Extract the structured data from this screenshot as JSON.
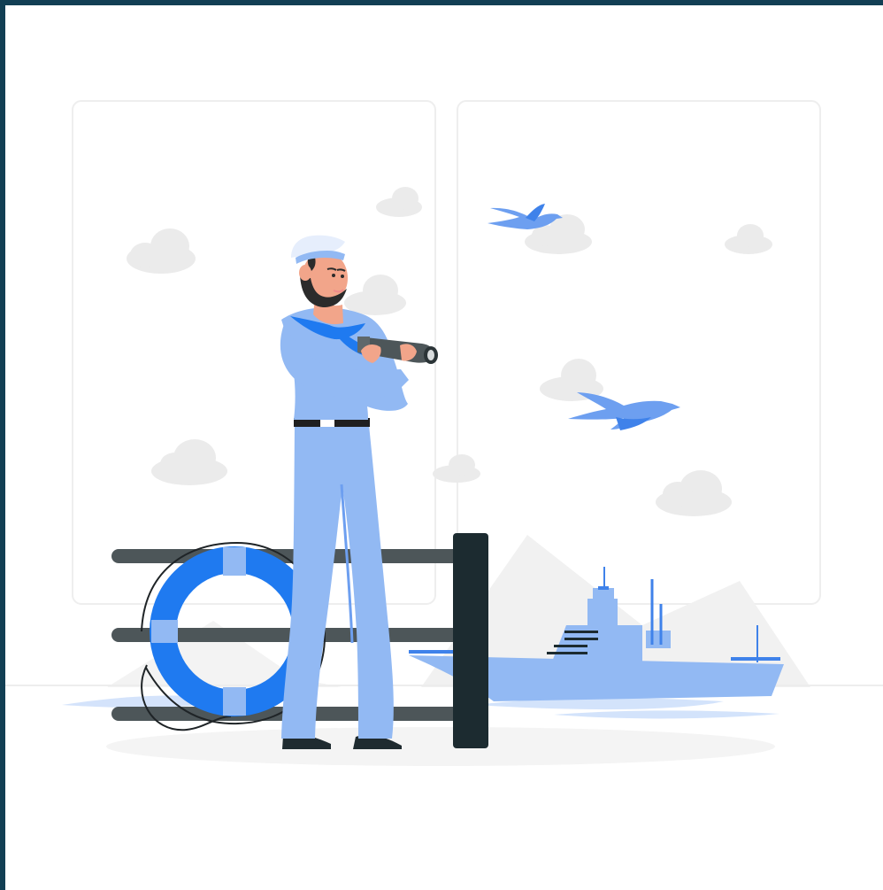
{
  "scene": {
    "icons": [
      "window-panel-icon",
      "cloud-icon",
      "bird-icon",
      "sailor-icon",
      "telescope-icon",
      "life-ring-icon",
      "railing-icon",
      "warship-icon",
      "mountain-icon"
    ]
  },
  "palette": {
    "frame": "#123f54",
    "background": "#ffffff",
    "panel_border": "#eeeeee",
    "cloud": "#ebebeb",
    "mountain": "#f0f0f0",
    "primary_blue": "#1f7af0",
    "light_blue": "#92b9f3",
    "pale_blue": "#cfe0fb",
    "railing_gray": "#4d5659",
    "post_dark": "#1c2b30",
    "shadow": "#f4f4f4",
    "skin": "#f2a58a",
    "beard": "#2b2b2b",
    "belt": "#1f1f1f"
  }
}
